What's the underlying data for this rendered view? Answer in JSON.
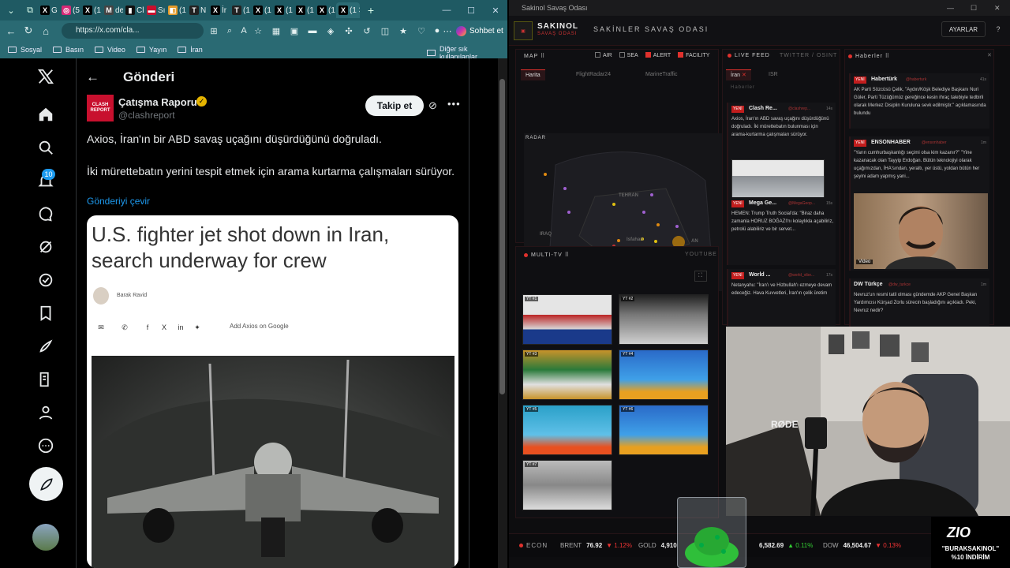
{
  "browser": {
    "tabs": [
      {
        "letter": "X",
        "text": "G",
        "color": "#000000"
      },
      {
        "letter": "◎",
        "text": "(5",
        "color": "#d62976"
      },
      {
        "letter": "X",
        "text": "(1",
        "color": "#000000"
      },
      {
        "letter": "M",
        "text": "de",
        "color": "#444444"
      },
      {
        "letter": "▮",
        "text": "Cl",
        "color": "#111111"
      },
      {
        "letter": "▬",
        "text": "Sı",
        "color": "#c8102e"
      },
      {
        "letter": "◧",
        "text": "(1",
        "color": "#e69b2a"
      },
      {
        "letter": "T",
        "text": "N",
        "color": "#222222"
      },
      {
        "letter": "X",
        "text": "İr",
        "color": "#000000"
      },
      {
        "letter": "T",
        "text": "(1",
        "color": "#222222"
      },
      {
        "letter": "X",
        "text": "(1",
        "color": "#000000"
      },
      {
        "letter": "X",
        "text": "(1",
        "color": "#000000"
      },
      {
        "letter": "X",
        "text": "(1",
        "color": "#000000"
      },
      {
        "letter": "X",
        "text": "(1",
        "color": "#000000"
      },
      {
        "letter": "X",
        "text": "(1",
        "color": "#000000"
      }
    ],
    "url": "https://x.com/cla...",
    "copilot_label": "Sohbet et",
    "bookmarks": [
      "Sosyal",
      "Basın",
      "Video",
      "Yayın",
      "İran"
    ],
    "other_bookmarks": "Diğer sık kullanılanlar"
  },
  "x": {
    "notification_count": "10",
    "page_title": "Gönderi",
    "author_name": "Çatışma Raporu",
    "author_handle": "@clashreport",
    "follow_label": "Takip et",
    "post_line1": "Axios, İran'ın bir ABD savaş uçağını düşürdüğünü doğruladı.",
    "post_line2": "İki mürettebatın yerini tespit etmek için arama kurtarma çalışmaları sürüyor.",
    "translate_label": "Gönderiyi çevir",
    "card": {
      "title": "U.S. fighter jet shot down in Iran, search underway for crew",
      "author": "Barak Ravid",
      "add_axios": "Add Axios on Google"
    }
  },
  "dashboard": {
    "window_title": "Sakinol Savaş Odası",
    "logo": "SAKINOL",
    "logo_sub": "SAVAŞ ODASI",
    "title": "SAKİNLER SAVAŞ ODASI",
    "settings_label": "AYARLAR",
    "map": {
      "label": "MAP",
      "filters": [
        {
          "name": "AIR",
          "on": false
        },
        {
          "name": "SEA",
          "on": false
        },
        {
          "name": "ALERT",
          "on": true
        },
        {
          "name": "FACILITY",
          "on": true
        }
      ],
      "tabs": [
        "Harita",
        "FlightRadar24",
        "MarineTraffic"
      ],
      "radar_label": "RADAR",
      "places": [
        "TEHRAN",
        "IRAQ",
        "KUWAIT",
        "AN",
        "Shiraz",
        "Isfahan"
      ]
    },
    "live_feed": {
      "label": "LIVE FEED",
      "sources": "TWITTER / OSINT",
      "tabs": [
        "İran",
        "ISR"
      ],
      "sub": "Haberler",
      "items": [
        {
          "badge": "YENİ",
          "name": "Clash Re...",
          "handle": "@clashrep...",
          "time": "14s",
          "text": "Axios, İran'ın ABD savaş uçağını düşürdüğünü doğruladı. İki mürettebatın bulunması için arama-kurtarma çalışmaları sürüyor."
        },
        {
          "badge": "YENİ",
          "name": "Mega Ge...",
          "handle": "@MegaGeop...",
          "time": "15s",
          "text": "HEMEN: Trump Truth Social'da: \"Biraz daha zamanla HORUZ BOĞAZI'nı kolaylıkla açabiliriz, petrolü alabiliriz ve bir servet..."
        },
        {
          "badge": "YENİ",
          "name": "World ...",
          "handle": "@world_vibe...",
          "time": "17s",
          "text": "Netanyahu: \"İran'ı ve Hizbullah'ı ezmeye devam edeceğiz. Hava Kuvvetleri, İran'ın çelik üretim"
        }
      ]
    },
    "news": {
      "label": "Haberler",
      "items": [
        {
          "badge": "YENİ",
          "name": "Habertürk",
          "handle": "@haberturk",
          "time": "41s",
          "text": "AK Parti Sözcüsü Çelik, \"Aydın/Köşk Belediye Başkanı Nuri Güler, Parti Tüzüğümüz gereğince kesin ihraç talebiyle tedbirli olarak Merkez Disiplin Kuruluna sevk edilmiştir.\" açıklamasında bulundu"
        },
        {
          "badge": "YENİ",
          "name": "ENSONHABER",
          "handle": "@ensonhaber",
          "time": "1m",
          "text": "\"Yarın cumhurbaşkanlığı seçimi olsa kim kazanır?\" \"Yine kazanacak olan Tayyip Erdoğan. Bütün teknolojiyi olarak uçağımızdan, İHA'sından, yeraltı, yer üstü, yoldan bütün her şeyini adam yapmış yani..."
        },
        {
          "badge": "",
          "name": "DW Türkçe",
          "handle": "@dw_turkce",
          "time": "1m",
          "text": "Nevruz'un resmi tatil olması gündemde AKP Genel Başkan Yardımcısı Kürşad Zorlu sürecin başladığını açıkladı. Peki, Nevruz nedir?"
        }
      ],
      "video_label": "Video"
    },
    "multitv": {
      "label": "MULTI-TV",
      "source": "YOUTUBE",
      "channels": [
        "YT #1",
        "YT #2",
        "YT #3",
        "YT #4",
        "YT #5",
        "YT #6",
        "YT #7"
      ]
    },
    "econ": {
      "label": "ECON",
      "items": [
        {
          "name": "BRENT",
          "value": "76.92",
          "change": "▼ 1.12%",
          "dir": "down"
        },
        {
          "name": "GOLD",
          "value": "4,910",
          "change": "",
          "dir": "up"
        },
        {
          "name": "",
          "value": "6,582.69",
          "change": "▲ 0.11%",
          "dir": "up"
        },
        {
          "name": "DOW",
          "value": "46,504.67",
          "change": "▼ 0.13%",
          "dir": "down"
        }
      ]
    },
    "overlay": {
      "brand": "ZIO",
      "promo_code": "\"BURAKSAKINOL\"",
      "promo_discount": "%10 İNDİRİM"
    }
  }
}
